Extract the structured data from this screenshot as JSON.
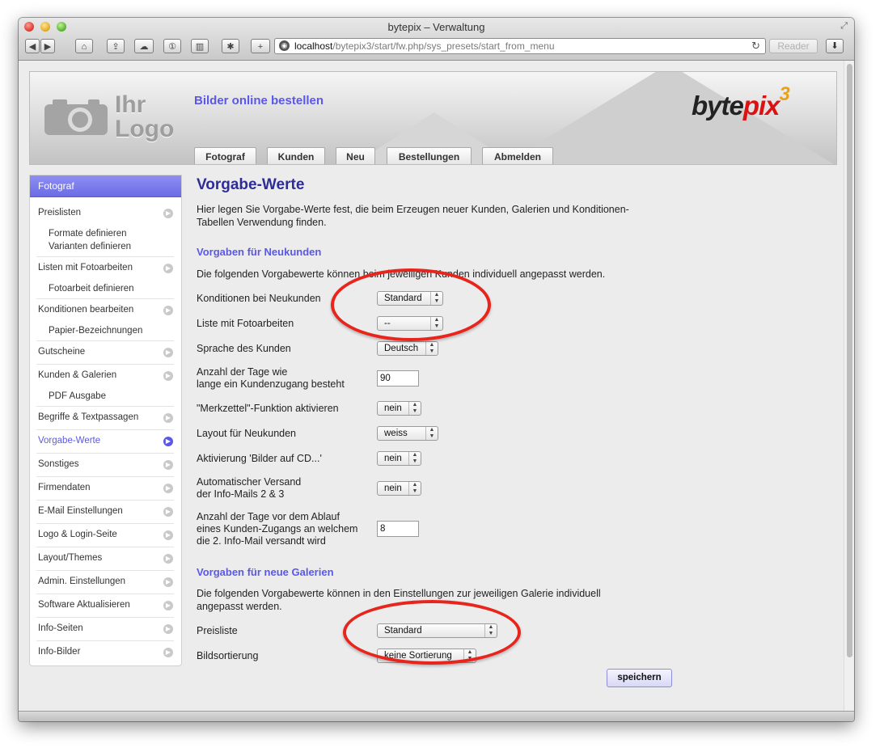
{
  "window": {
    "title": "bytepix – Verwaltung",
    "url_host": "localhost",
    "url_path": "/bytepix3/start/fw.php/sys_presets/start_from_menu",
    "reader_label": "Reader"
  },
  "header": {
    "logo_line1": "Ihr",
    "logo_line2": "Logo",
    "tagline": "Bilder online bestellen",
    "brand_a": "byte",
    "brand_b": "pix",
    "brand_sup": "3",
    "nav": [
      "Fotograf",
      "Kunden",
      "Neu",
      "Bestellungen",
      "Abmelden"
    ]
  },
  "sidebar": {
    "title": "Fotograf",
    "items": [
      {
        "label": "Preislisten"
      },
      {
        "label": "Formate definieren"
      },
      {
        "label": "Varianten definieren"
      },
      {
        "label": "Listen mit Fotoarbeiten"
      },
      {
        "label": "Fotoarbeit definieren"
      },
      {
        "label": "Konditionen bearbeiten"
      },
      {
        "label": "Papier-Bezeichnungen"
      },
      {
        "label": "Gutscheine"
      },
      {
        "label": "Kunden & Galerien"
      },
      {
        "label": "PDF Ausgabe"
      },
      {
        "label": "Begriffe & Textpassagen"
      },
      {
        "label": "Vorgabe-Werte"
      },
      {
        "label": "Sonstiges"
      },
      {
        "label": "Firmendaten"
      },
      {
        "label": "E-Mail Einstellungen"
      },
      {
        "label": "Logo & Login-Seite"
      },
      {
        "label": "Layout/Themes"
      },
      {
        "label": "Admin. Einstellungen"
      },
      {
        "label": "Software Aktualisieren"
      },
      {
        "label": "Info-Seiten"
      },
      {
        "label": "Info-Bilder"
      }
    ]
  },
  "main": {
    "title": "Vorgabe-Werte",
    "intro_line1": "Hier legen Sie Vorgabe-Werte fest, die beim Erzeugen neuer Kunden, Galerien und Konditionen-",
    "intro_line2": "Tabellen Verwendung finden.",
    "section1": {
      "heading": "Vorgaben für Neukunden",
      "desc": "Die folgenden Vorgabewerte können beim jeweiligen Kunden individuell angepasst werden.",
      "fields": [
        {
          "label": "Konditionen bei Neukunden",
          "value": "Standard"
        },
        {
          "label": "Liste mit Fotoarbeiten",
          "value": "--"
        },
        {
          "label": "Sprache des Kunden",
          "value": "Deutsch"
        },
        {
          "label_line1": "Anzahl der Tage wie",
          "label_line2": "lange ein Kundenzugang besteht",
          "value": "90"
        },
        {
          "label": "\"Merkzettel\"-Funktion aktivieren",
          "value": "nein"
        },
        {
          "label": "Layout für Neukunden",
          "value": "weiss"
        },
        {
          "label": "Aktivierung 'Bilder auf CD...'",
          "value": "nein"
        },
        {
          "label_line1": "Automatischer Versand",
          "label_line2": "der Info-Mails 2 & 3",
          "value": "nein"
        },
        {
          "label_line1": "Anzahl der Tage vor dem Ablauf",
          "label_line2": "eines Kunden-Zugangs an welchem",
          "label_line3": "die 2. Info-Mail versandt wird",
          "value": "8"
        }
      ]
    },
    "section2": {
      "heading": "Vorgaben für neue Galerien",
      "desc_line1": "Die folgenden Vorgabewerte können in den Einstellungen zur jeweiligen Galerie individuell",
      "desc_line2": "angepasst werden.",
      "fields": [
        {
          "label": "Preisliste",
          "value": "Standard"
        },
        {
          "label": "Bildsortierung",
          "value": "keine Sortierung"
        }
      ]
    },
    "save_label": "speichern"
  },
  "colors": {
    "accent": "#5a58e6",
    "title": "#2e2c96",
    "highlight_ring": "#e8251c"
  }
}
